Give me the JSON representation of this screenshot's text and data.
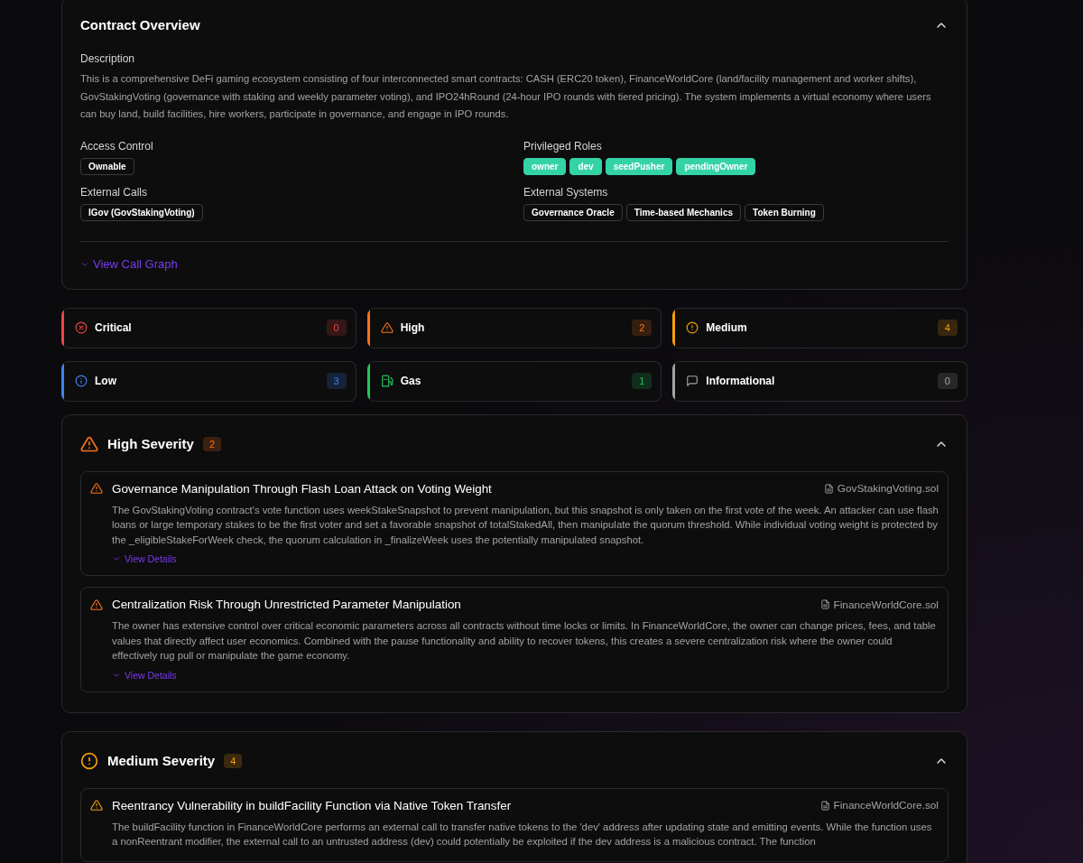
{
  "overview": {
    "title": "Contract Overview",
    "description_label": "Description",
    "description": "This is a comprehensive DeFi gaming ecosystem consisting of four interconnected smart contracts: CASH (ERC20 token), FinanceWorldCore (land/facility management and worker shifts), GovStakingVoting (governance with staking and weekly parameter voting), and IPO24hRound (24-hour IPO rounds with tiered pricing). The system implements a virtual economy where users can buy land, build facilities, hire workers, participate in governance, and engage in IPO rounds.",
    "groups": [
      {
        "label": "Access Control",
        "kind": "plain",
        "tags": [
          "Ownable"
        ]
      },
      {
        "label": "Privileged Roles",
        "kind": "role",
        "tags": [
          "owner",
          "dev",
          "seedPusher",
          "pendingOwner"
        ]
      },
      {
        "label": "External Calls",
        "kind": "plain",
        "tags": [
          "IGov (GovStakingVoting)"
        ]
      },
      {
        "label": "External Systems",
        "kind": "plain",
        "tags": [
          "Governance Oracle",
          "Time-based Mechanics",
          "Token Burning"
        ]
      }
    ],
    "link": "View Call Graph"
  },
  "stats": [
    {
      "label": "Critical",
      "count": "0",
      "kind": "critical",
      "color": "#ef4444"
    },
    {
      "label": "High",
      "count": "2",
      "kind": "high",
      "color": "#f97316"
    },
    {
      "label": "Medium",
      "count": "4",
      "kind": "medium",
      "color": "#f59e0b"
    },
    {
      "label": "Low",
      "count": "3",
      "kind": "low",
      "color": "#3b82f6"
    },
    {
      "label": "Gas",
      "count": "1",
      "kind": "gas",
      "color": "#22c55e"
    },
    {
      "label": "Informational",
      "count": "0",
      "kind": "info",
      "color": "#a3a3a3"
    }
  ],
  "sections": [
    {
      "title": "High Severity",
      "count": "2",
      "kind": "high",
      "color": "#f97316",
      "findings": [
        {
          "title": "Governance Manipulation Through Flash Loan Attack on Voting Weight",
          "file": "GovStakingVoting.sol",
          "description": "The GovStakingVoting contract's vote function uses weekStakeSnapshot to prevent manipulation, but this snapshot is only taken on the first vote of the week. An attacker can use flash loans or large temporary stakes to be the first voter and set a favorable snapshot of totalStakedAll, then manipulate the quorum threshold. While individual voting weight is protected by the _eligibleStakeForWeek check, the quorum calculation in _finalizeWeek uses the potentially manipulated snapshot.",
          "link": "View Details"
        },
        {
          "title": "Centralization Risk Through Unrestricted Parameter Manipulation",
          "file": "FinanceWorldCore.sol",
          "description": "The owner has extensive control over critical economic parameters across all contracts without time locks or limits. In FinanceWorldCore, the owner can change prices, fees, and table values that directly affect user economics. Combined with the pause functionality and ability to recover tokens, this creates a severe centralization risk where the owner could effectively rug pull or manipulate the game economy.",
          "link": "View Details"
        }
      ]
    },
    {
      "title": "Medium Severity",
      "count": "4",
      "kind": "medium",
      "color": "#f59e0b",
      "findings": [
        {
          "title": "Reentrancy Vulnerability in buildFacility Function via Native Token Transfer",
          "file": "FinanceWorldCore.sol",
          "description": "The buildFacility function in FinanceWorldCore performs an external call to transfer native tokens to the 'dev' address after updating state and emitting events. While the function uses a nonReentrant modifier, the external call to an untrusted address (dev) could potentially be exploited if the dev address is a malicious contract. The function"
        }
      ]
    }
  ]
}
